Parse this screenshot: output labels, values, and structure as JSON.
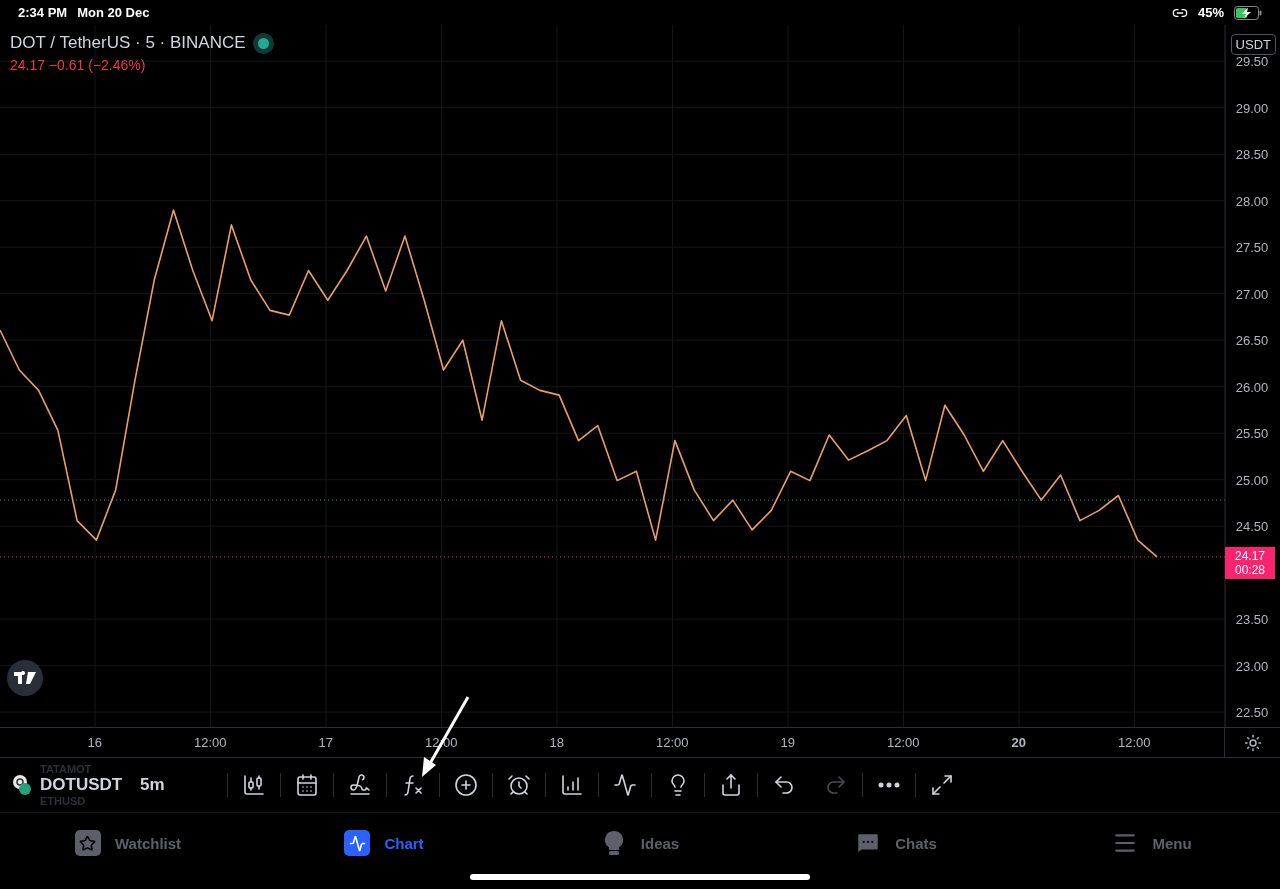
{
  "status_bar": {
    "time": "2:34 PM",
    "date": "Mon 20 Dec",
    "battery": "45%",
    "charging": true
  },
  "chart_header": {
    "title": "DOT / TetherUS · 5 · BINANCE",
    "market_open": true,
    "quote": "24.17 −0.61 (−2.46%)"
  },
  "price_axis": {
    "currency": "USDT",
    "last_price": "24.17",
    "countdown": "00:28"
  },
  "chart_data": {
    "type": "line",
    "grid": true,
    "series": [
      {
        "color": "#eba063",
        "values": [
          26.61,
          26.18,
          25.96,
          25.53,
          24.56,
          24.35,
          24.89,
          26.07,
          27.15,
          27.9,
          27.25,
          26.71,
          27.74,
          27.15,
          26.82,
          26.77,
          27.25,
          26.93,
          27.25,
          27.62,
          27.03,
          27.62,
          26.93,
          26.18,
          26.5,
          25.64,
          26.71,
          26.07,
          25.96,
          25.91,
          25.42,
          25.58,
          24.99,
          25.09,
          24.35,
          25.42,
          24.89,
          24.56,
          24.78,
          24.46,
          24.67,
          25.09,
          24.99,
          25.48,
          25.21,
          25.31,
          25.42,
          25.69,
          24.99,
          25.8,
          25.48,
          25.09,
          25.42,
          25.09,
          24.78,
          25.05,
          24.56,
          24.67,
          24.83,
          24.35,
          24.17
        ]
      }
    ],
    "ylim": [
      22.34,
      29.89
    ],
    "yticks": [
      {
        "value": 22.5,
        "label": "22.50"
      },
      {
        "value": 23,
        "label": "23.00"
      },
      {
        "value": 23.5,
        "label": "23.50"
      },
      {
        "value": 24.5,
        "label": "24.50"
      },
      {
        "value": 25,
        "label": "25.00"
      },
      {
        "value": 25.5,
        "label": "25.50"
      },
      {
        "value": 26,
        "label": "26.00"
      },
      {
        "value": 26.5,
        "label": "26.50"
      },
      {
        "value": 27,
        "label": "27.00"
      },
      {
        "value": 27.5,
        "label": "27.50"
      },
      {
        "value": 28,
        "label": "28.00"
      },
      {
        "value": 28.5,
        "label": "28.50"
      },
      {
        "value": 29,
        "label": "29.00"
      },
      {
        "value": 29.5,
        "label": "29.50"
      }
    ]
  },
  "time_axis": [
    {
      "label": "16",
      "emphasized": false
    },
    {
      "label": "12:00",
      "emphasized": false
    },
    {
      "label": "17",
      "emphasized": false
    },
    {
      "label": "12:00",
      "emphasized": false
    },
    {
      "label": "18",
      "emphasized": false
    },
    {
      "label": "12:00",
      "emphasized": false
    },
    {
      "label": "19",
      "emphasized": false
    },
    {
      "label": "12:00",
      "emphasized": false
    },
    {
      "label": "20",
      "emphasized": true
    },
    {
      "label": "12:00",
      "emphasized": false
    }
  ],
  "toolbar": {
    "symbol_above": "TATAMOT",
    "symbol": "DOTUSDT",
    "symbol_below": "ETHUSD",
    "interval": "5m",
    "tools": [
      {
        "disabled": false
      },
      {
        "disabled": false
      },
      {
        "disabled": false
      },
      {
        "disabled": false
      },
      {
        "disabled": false
      },
      {
        "disabled": false
      },
      {
        "disabled": false
      },
      {
        "disabled": false
      },
      {
        "disabled": false
      },
      {
        "disabled": false
      },
      {
        "disabled": false
      },
      {
        "disabled": true
      },
      {
        "disabled": false
      },
      {
        "disabled": false
      }
    ]
  },
  "bottom_nav": [
    {
      "label": "Watchlist",
      "selected": false
    },
    {
      "label": "Chart",
      "selected": true
    },
    {
      "label": "Ideas",
      "selected": false
    },
    {
      "label": "Chats",
      "selected": false
    },
    {
      "label": "Menu",
      "selected": false
    }
  ]
}
